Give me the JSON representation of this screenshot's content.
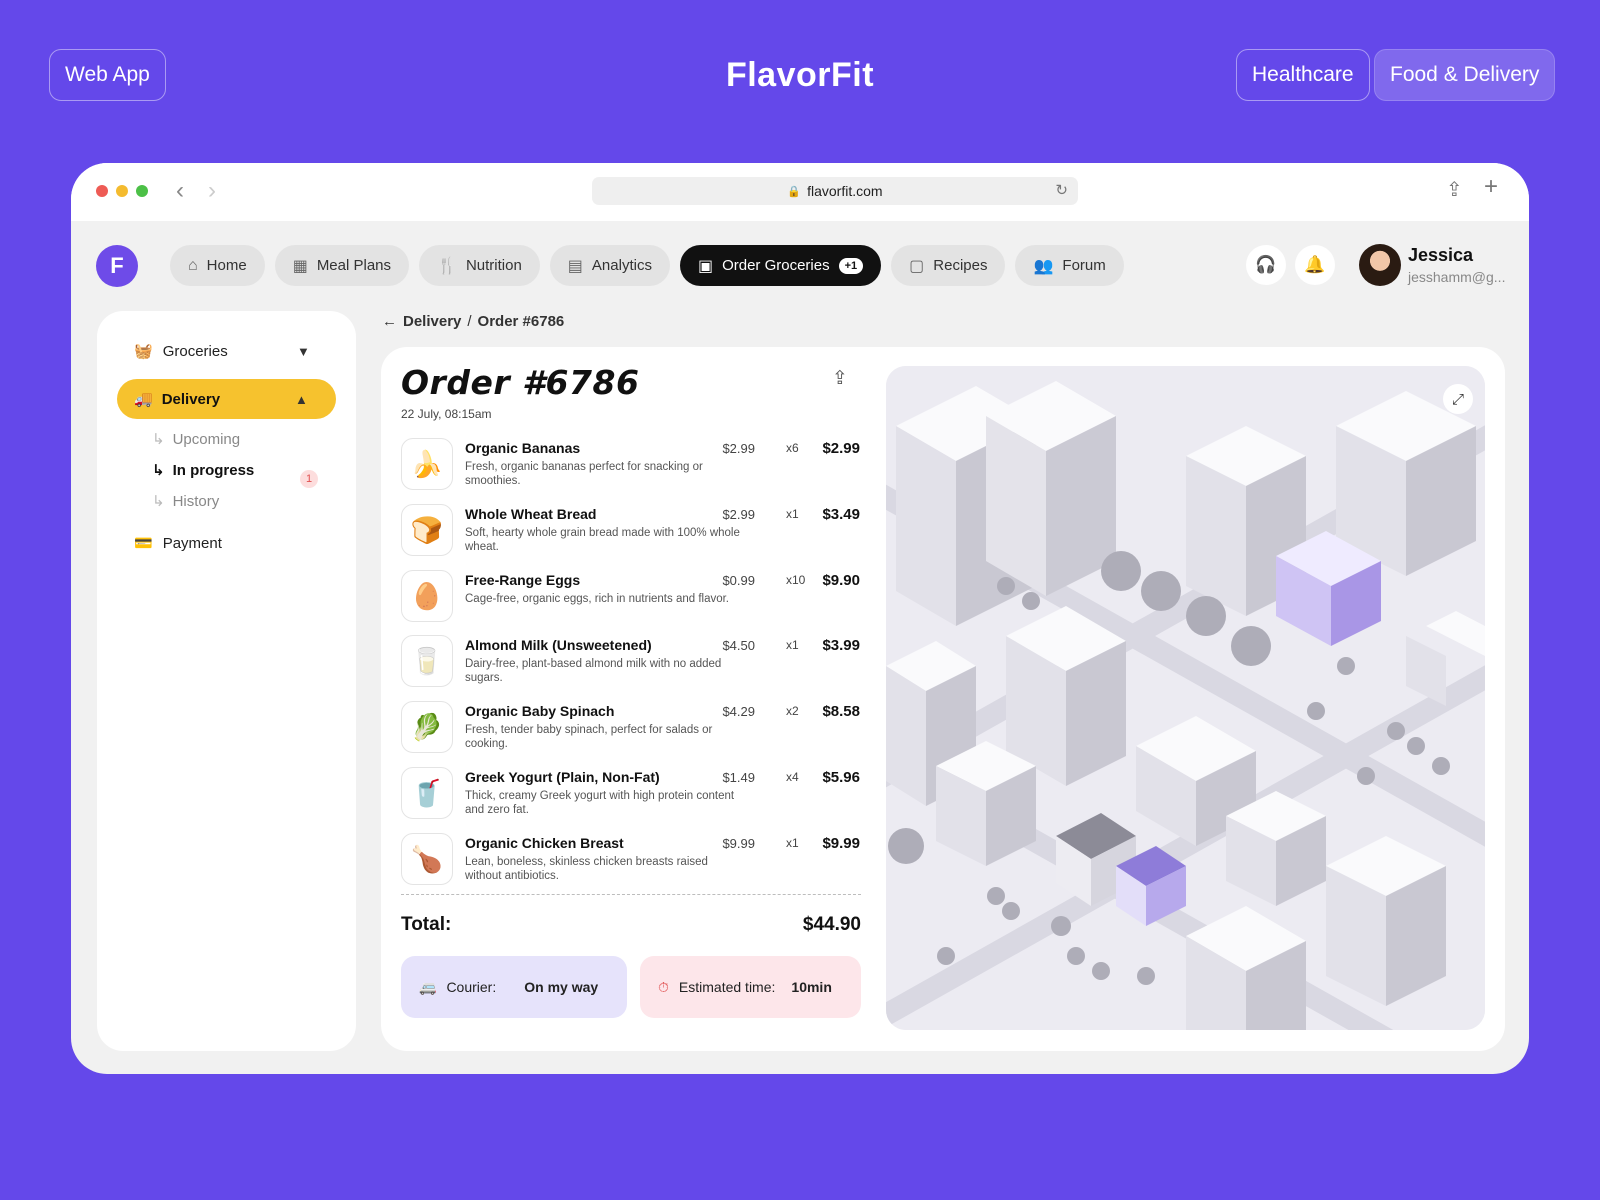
{
  "showcase": {
    "left_pill": "Web App",
    "brand": "FlavorFit",
    "right_pills": [
      "Healthcare",
      "Food & Delivery"
    ]
  },
  "browser": {
    "url": "flavorfit.com"
  },
  "app": {
    "logo_letter": "F",
    "nav": [
      {
        "label": "Home",
        "icon": "home-icon"
      },
      {
        "label": "Meal Plans",
        "icon": "calendar-icon"
      },
      {
        "label": "Nutrition",
        "icon": "utensils-icon"
      },
      {
        "label": "Analytics",
        "icon": "chart-icon"
      },
      {
        "label": "Order Groceries",
        "icon": "store-icon",
        "badge": "+1",
        "active": true
      },
      {
        "label": "Recipes",
        "icon": "book-icon"
      },
      {
        "label": "Forum",
        "icon": "users-icon"
      }
    ],
    "user": {
      "name": "Jessica",
      "email": "jesshamm@g..."
    }
  },
  "sidebar": {
    "groceries": "Groceries",
    "delivery": "Delivery",
    "sub_items": [
      "Upcoming",
      "In progress",
      "History"
    ],
    "in_progress_count": "1",
    "payment": "Payment"
  },
  "breadcrumb": {
    "parent": "Delivery",
    "sep": "/",
    "current": "Order #6786"
  },
  "order": {
    "title": "Order #6786",
    "date": "22 July, 08:15am",
    "items": [
      {
        "name": "Organic Bananas",
        "desc": "Fresh, organic bananas perfect for snacking or smoothies.",
        "price": "$2.99",
        "qty": "x6",
        "total": "$2.99",
        "icon": "🍌"
      },
      {
        "name": "Whole Wheat Bread",
        "desc": "Soft, hearty whole grain bread made with 100% whole wheat.",
        "price": "$2.99",
        "qty": "x1",
        "total": "$3.49",
        "icon": "🍞"
      },
      {
        "name": "Free-Range Eggs",
        "desc": "Cage-free, organic eggs, rich in nutrients and flavor.",
        "price": "$0.99",
        "qty": "x10",
        "total": "$9.90",
        "icon": "🥚"
      },
      {
        "name": "Almond Milk (Unsweetened)",
        "desc": "Dairy-free, plant-based almond milk with no added sugars.",
        "price": "$4.50",
        "qty": "x1",
        "total": "$3.99",
        "icon": "🥛"
      },
      {
        "name": "Organic Baby Spinach",
        "desc": "Fresh, tender baby spinach, perfect for salads or cooking.",
        "price": "$4.29",
        "qty": "x2",
        "total": "$8.58",
        "icon": "🥬"
      },
      {
        "name": "Greek Yogurt (Plain, Non-Fat)",
        "desc": "Thick, creamy Greek yogurt with high protein content and zero fat.",
        "price": "$1.49",
        "qty": "x4",
        "total": "$5.96",
        "icon": "🥤"
      },
      {
        "name": "Organic Chicken Breast",
        "desc": "Lean, boneless, skinless chicken breasts raised without antibiotics.",
        "price": "$9.99",
        "qty": "x1",
        "total": "$9.99",
        "icon": "🍗"
      }
    ],
    "total_label": "Total:",
    "total_value": "$44.90",
    "courier_label": "Courier:",
    "courier_value": "On my way",
    "eta_label": "Estimated time:",
    "eta_value": "10min"
  },
  "colors": {
    "background": "#6448EA",
    "accent_yellow": "#F6C22E",
    "courier_bg": "#E6E3FB",
    "eta_bg": "#FDE6EA"
  }
}
